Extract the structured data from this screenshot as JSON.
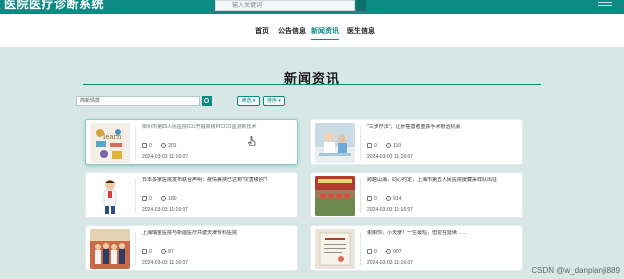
{
  "header": {
    "brand": "医院医疗诊断系统",
    "search_placeholder": "输入关键词"
  },
  "nav": [
    {
      "label": "首页"
    },
    {
      "label": "公告信息"
    },
    {
      "label": "新闻资讯",
      "active": true
    },
    {
      "label": "医生信息"
    }
  ],
  "page": {
    "title": "新闻资讯",
    "search_placeholder": "简新情款",
    "filter_label": "筛选 ▾",
    "sort_label": "排序 ▾"
  },
  "cards": [
    {
      "title": "柳州市第四人民医院ICU开展高级PICCO监测新技术",
      "likes": "0",
      "views": "201",
      "date": "2024-03-03 11:16:07"
    },
    {
      "title": "\"三步疗法\"，让肝癌患者重获手术根治机会",
      "likes": "0",
      "views": "110",
      "date": "2024-03-03 11:16:07"
    },
    {
      "title": "日本多家医院发布联合声明：疫情裹挟已达到\"灾害级别\"！",
      "likes": "0",
      "views": "180",
      "date": "2024-03-03 11:16:07"
    },
    {
      "title": "跨越山海，同心约定，上海市第五人民医院援藏采样队出征",
      "likes": "0",
      "views": "614",
      "date": "2024-03-03 11:16:07"
    },
    {
      "title": "上海瑞金医院与新疆医疗共建天津专科医院",
      "likes": "0",
      "views": "87",
      "date": "2024-03-03 11:16:07"
    },
    {
      "title": "谢谢你，小天使！一生最短，但爱在延续……",
      "likes": "0",
      "views": "907",
      "date": "2024-03-03 11:16:07"
    }
  ],
  "watermark": "CSDN @w_danpianji889",
  "colors": {
    "accent": "#0e8a84",
    "background": "#d7e7e6"
  }
}
